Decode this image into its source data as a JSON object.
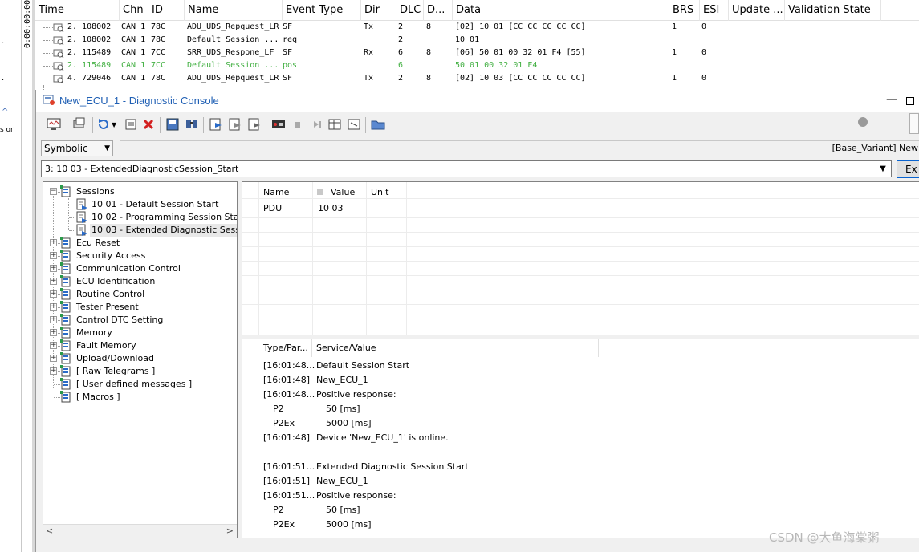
{
  "left_strip": {
    "time_axis": "0:00:00:00",
    "glyphs": [
      ".",
      ".",
      "^",
      "s or"
    ]
  },
  "trace": {
    "columns": [
      "Time",
      "Chn",
      "ID",
      "Name",
      "Event Type",
      "Dir",
      "DLC",
      "D...",
      "Data",
      "BRS",
      "ESI",
      "Update ...",
      "Validation State"
    ],
    "rows": [
      {
        "time": "2. 108002",
        "chn": "CAN 1",
        "id": "78C",
        "name": "ADU_UDS_Repquest_LR",
        "event": "SF",
        "dir": "Tx",
        "dlc": "2",
        "d": "8",
        "data": "[02] 10 01 [CC CC CC CC CC]",
        "brs": "1",
        "esi": "0",
        "green": false
      },
      {
        "time": "2. 108002",
        "chn": "CAN 1",
        "id": "78C",
        "name": "Default Session ...",
        "event": "req",
        "dir": "",
        "dlc": "2",
        "d": "",
        "data": "10 01",
        "brs": "",
        "esi": "",
        "green": false
      },
      {
        "time": "2. 115489",
        "chn": "CAN 1",
        "id": "7CC",
        "name": "SRR_UDS_Respone_LF",
        "event": "SF",
        "dir": "Rx",
        "dlc": "6",
        "d": "8",
        "data": "[06] 50 01 00 32 01 F4 [55]",
        "brs": "1",
        "esi": "0",
        "green": false
      },
      {
        "time": "2. 115489",
        "chn": "CAN 1",
        "id": "7CC",
        "name": "Default Session ...",
        "event": "pos",
        "dir": "",
        "dlc": "6",
        "d": "",
        "data": "50 01 00 32 01 F4",
        "brs": "",
        "esi": "",
        "green": true
      },
      {
        "time": "4. 729046",
        "chn": "CAN 1",
        "id": "78C",
        "name": "ADU_UDS_Repquest_LR",
        "event": "SF",
        "dir": "Tx",
        "dlc": "2",
        "d": "8",
        "data": "[02] 10 03 [CC CC CC CC CC]",
        "brs": "1",
        "esi": "0",
        "green": false
      }
    ]
  },
  "console": {
    "title": "New_ECU_1 - Diagnostic Console",
    "minimize_glyph": "—",
    "symbolic": "Symbolic",
    "variant": "[Base_Variant] New",
    "service": "3: 10 03 - ExtendedDiagnosticSession_Start",
    "execute_label": "Ex",
    "tree": [
      {
        "label": "Sessions",
        "level": 0,
        "expander": "−"
      },
      {
        "label": "10 01 - Default Session Start",
        "level": 1
      },
      {
        "label": "10 02 - Programming Session Start",
        "level": 1
      },
      {
        "label": "10 03 - Extended Diagnostic Session",
        "level": 1,
        "selected": true
      },
      {
        "label": "Ecu Reset",
        "level": 0,
        "expander": "+"
      },
      {
        "label": "Security Access",
        "level": 0,
        "expander": "+"
      },
      {
        "label": "Communication Control",
        "level": 0,
        "expander": "+"
      },
      {
        "label": "ECU Identification",
        "level": 0,
        "expander": "+"
      },
      {
        "label": "Routine Control",
        "level": 0,
        "expander": "+"
      },
      {
        "label": "Tester Present",
        "level": 0,
        "expander": "+"
      },
      {
        "label": "Control DTC Setting",
        "level": 0,
        "expander": "+"
      },
      {
        "label": "Memory",
        "level": 0,
        "expander": "+"
      },
      {
        "label": "Fault Memory",
        "level": 0,
        "expander": "+"
      },
      {
        "label": "Upload/Download",
        "level": 0,
        "expander": "+"
      },
      {
        "label": "[ Raw Telegrams ]",
        "level": 0,
        "expander": "+"
      },
      {
        "label": "[ User defined messages ]",
        "level": 0
      },
      {
        "label": "[ Macros ]",
        "level": 0
      }
    ],
    "params": {
      "headers": {
        "name": "Name",
        "value": "Value",
        "unit": "Unit"
      },
      "rows": [
        {
          "name": "PDU",
          "value": "10 03",
          "unit": ""
        }
      ]
    },
    "log": {
      "headers": {
        "type": "Type/Par...",
        "service": "Service/Value"
      },
      "lines": [
        {
          "type": "[16:01:48...",
          "value": "Default Session Start"
        },
        {
          "type": "[16:01:48]",
          "value": "New_ECU_1"
        },
        {
          "type": "[16:01:48...",
          "value": "Positive response:"
        },
        {
          "param": "P2",
          "pval": "50 [ms]"
        },
        {
          "param": "P2Ex",
          "pval": "5000 [ms]"
        },
        {
          "type": "[16:01:48]",
          "value": "Device 'New_ECU_1' is online."
        },
        {
          "type": "",
          "value": ""
        },
        {
          "type": "[16:01:51...",
          "value": "Extended Diagnostic Session Start"
        },
        {
          "type": "[16:01:51]",
          "value": "New_ECU_1"
        },
        {
          "type": "[16:01:51...",
          "value": "Positive response:"
        },
        {
          "param": "P2",
          "pval": "50 [ms]"
        },
        {
          "param": "P2Ex",
          "pval": "5000 [ms]"
        }
      ]
    }
  },
  "watermark": "CSDN @大鱼海棠粥",
  "colors": {
    "title_blue": "#1f5fb4",
    "green_row": "#43b043"
  }
}
